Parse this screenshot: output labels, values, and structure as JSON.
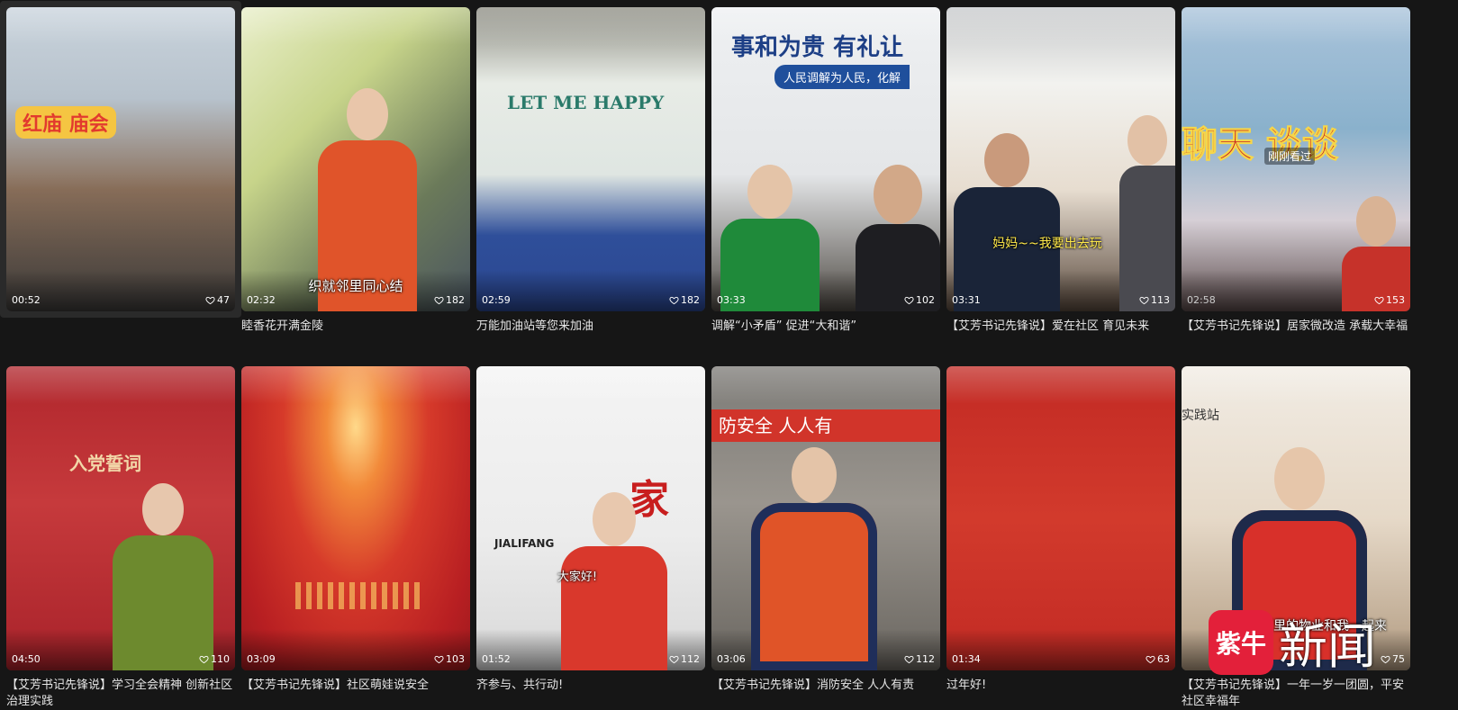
{
  "videos": [
    {
      "duration": "00:52",
      "likes": "47",
      "title": "",
      "sign": "红庙 庙会",
      "caption": ""
    },
    {
      "duration": "02:32",
      "likes": "182",
      "title": "睦香花开满金陵",
      "sign": "",
      "caption": "织就邻里同心结"
    },
    {
      "duration": "02:59",
      "likes": "182",
      "title": "万能加油站等您来加油",
      "sign": "LET ME HAPPY",
      "caption": ""
    },
    {
      "duration": "03:33",
      "likes": "102",
      "title": "调解“小矛盾” 促进“大和谐”",
      "sign": "事和为贵 有礼让",
      "banner": "人民调解为人民，化解",
      "caption": ""
    },
    {
      "duration": "03:31",
      "likes": "113",
      "title": "【艾芳书记先锋说】爱在社区 育见未来",
      "sign": "",
      "caption": "妈妈~~我要出去玩"
    },
    {
      "duration": "02:58",
      "likes": "153",
      "title": "【艾芳书记先锋说】居家微改造 承载大幸福",
      "sign": "聊天 谈谈",
      "badge": "刚刚看过",
      "caption": ""
    },
    {
      "duration": "04:50",
      "likes": "110",
      "title": "【艾芳书记先锋说】学习全会精神 创新社区治理实践",
      "sign": "入党誓词",
      "caption": ""
    },
    {
      "duration": "03:09",
      "likes": "103",
      "title": "【艾芳书记先锋说】社区萌娃说安全",
      "sign": "",
      "caption": ""
    },
    {
      "duration": "01:52",
      "likes": "112",
      "title": "齐参与、共行动!",
      "sign": "家",
      "wall": "JIALIFANG",
      "caption": "大家好!"
    },
    {
      "duration": "03:06",
      "likes": "112",
      "title": "【艾芳书记先锋说】消防安全 人人有责",
      "sign": "防安全  人人有",
      "caption": ""
    },
    {
      "duration": "01:34",
      "likes": "63",
      "title": "过年好!",
      "sign": "",
      "caption": ""
    },
    {
      "duration": "",
      "likes": "75",
      "title": "【艾芳书记先锋说】一年一岁一团圆，平安社区幸福年",
      "sign": "实践站",
      "caption": "管辖区里的物业和我一起来"
    }
  ],
  "logo": {
    "badge": "紫牛",
    "text": "新闻"
  },
  "colors": {
    "background": "#161616",
    "text": "#e6e6e6",
    "accent_red": "#d8262c"
  }
}
